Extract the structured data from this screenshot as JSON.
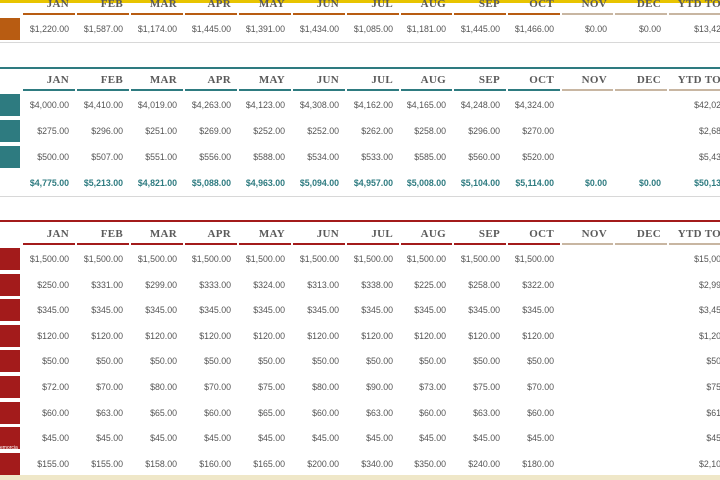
{
  "months": [
    "JAN",
    "FEB",
    "MAR",
    "APR",
    "MAY",
    "JUN",
    "JUL",
    "AUG",
    "SEP",
    "OCT",
    "NOV",
    "DEC"
  ],
  "ytd_label": "YTD TO",
  "colors": {
    "income": "#b85c12",
    "savings": "#2e7b80",
    "expenses": "#a31b1b",
    "accent": "#e8c400"
  },
  "income": {
    "rows": [
      [
        "$1,220.00",
        "$1,587.00",
        "$1,174.00",
        "$1,445.00",
        "$1,391.00",
        "$1,434.00",
        "$1,085.00",
        "$1,181.00",
        "$1,445.00",
        "$1,466.00",
        "$0.00",
        "$0.00",
        "$13,42"
      ]
    ]
  },
  "savings": {
    "rows": [
      [
        "$4,000.00",
        "$4,410.00",
        "$4,019.00",
        "$4,263.00",
        "$4,123.00",
        "$4,308.00",
        "$4,162.00",
        "$4,165.00",
        "$4,248.00",
        "$4,324.00",
        "",
        "",
        "$42,02"
      ],
      [
        "$275.00",
        "$296.00",
        "$251.00",
        "$269.00",
        "$252.00",
        "$252.00",
        "$262.00",
        "$258.00",
        "$296.00",
        "$270.00",
        "",
        "",
        "$2,68"
      ],
      [
        "$500.00",
        "$507.00",
        "$551.00",
        "$556.00",
        "$588.00",
        "$534.00",
        "$533.00",
        "$585.00",
        "$560.00",
        "$520.00",
        "",
        "",
        "$5,43"
      ]
    ],
    "total": [
      "$4,775.00",
      "$5,213.00",
      "$4,821.00",
      "$5,088.00",
      "$4,963.00",
      "$5,094.00",
      "$4,957.00",
      "$5,008.00",
      "$5,104.00",
      "$5,114.00",
      "$0.00",
      "$0.00",
      "$50,13"
    ]
  },
  "expenses": {
    "rows": [
      [
        "$1,500.00",
        "$1,500.00",
        "$1,500.00",
        "$1,500.00",
        "$1,500.00",
        "$1,500.00",
        "$1,500.00",
        "$1,500.00",
        "$1,500.00",
        "$1,500.00",
        "",
        "",
        "$15,00"
      ],
      [
        "$250.00",
        "$331.00",
        "$299.00",
        "$333.00",
        "$324.00",
        "$313.00",
        "$338.00",
        "$225.00",
        "$258.00",
        "$322.00",
        "",
        "",
        "$2,99"
      ],
      [
        "$345.00",
        "$345.00",
        "$345.00",
        "$345.00",
        "$345.00",
        "$345.00",
        "$345.00",
        "$345.00",
        "$345.00",
        "$345.00",
        "",
        "",
        "$3,45"
      ],
      [
        "$120.00",
        "$120.00",
        "$120.00",
        "$120.00",
        "$120.00",
        "$120.00",
        "$120.00",
        "$120.00",
        "$120.00",
        "$120.00",
        "",
        "",
        "$1,20"
      ],
      [
        "$50.00",
        "$50.00",
        "$50.00",
        "$50.00",
        "$50.00",
        "$50.00",
        "$50.00",
        "$50.00",
        "$50.00",
        "$50.00",
        "",
        "",
        "$50"
      ],
      [
        "$72.00",
        "$70.00",
        "$80.00",
        "$70.00",
        "$75.00",
        "$80.00",
        "$90.00",
        "$73.00",
        "$75.00",
        "$70.00",
        "",
        "",
        "$75"
      ],
      [
        "$60.00",
        "$63.00",
        "$65.00",
        "$60.00",
        "$65.00",
        "$60.00",
        "$63.00",
        "$60.00",
        "$63.00",
        "$60.00",
        "",
        "",
        "$61"
      ],
      [
        "$45.00",
        "$45.00",
        "$45.00",
        "$45.00",
        "$45.00",
        "$45.00",
        "$45.00",
        "$45.00",
        "$45.00",
        "$45.00",
        "",
        "",
        "$45"
      ],
      [
        "$155.00",
        "$155.00",
        "$158.00",
        "$160.00",
        "$165.00",
        "$200.00",
        "$340.00",
        "$350.00",
        "$240.00",
        "$180.00",
        "",
        "",
        "$2,10"
      ]
    ]
  },
  "fragments": {
    "tiny_label": "emorcia"
  }
}
